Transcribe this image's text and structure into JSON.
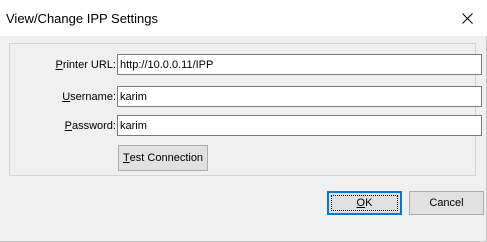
{
  "window": {
    "title": "View/Change IPP Settings",
    "close_icon": "close-icon"
  },
  "form": {
    "printer_url": {
      "label_mnemonic": "P",
      "label_rest": "rinter URL:",
      "value": "http://10.0.0.11/IPP"
    },
    "username": {
      "label_mnemonic": "U",
      "label_rest": "sername:",
      "value": "karim"
    },
    "password": {
      "label_mnemonic": "P",
      "label_rest": "assword:",
      "value": "karim"
    },
    "test_connection": {
      "label_mnemonic": "T",
      "label_rest": "est Connection"
    }
  },
  "buttons": {
    "ok": {
      "label_mnemonic": "O",
      "label_rest": "K"
    },
    "cancel": {
      "label": "Cancel"
    }
  }
}
